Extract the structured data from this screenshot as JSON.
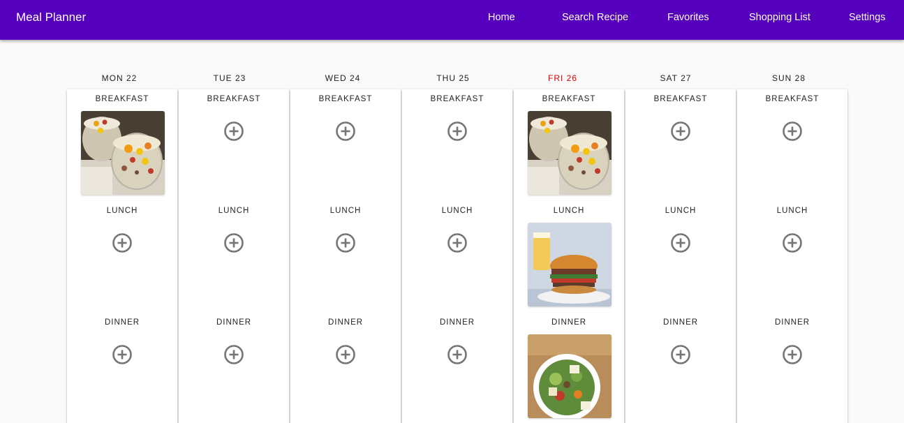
{
  "app": {
    "title": "Meal Planner"
  },
  "nav": {
    "home": "Home",
    "search": "Search Recipe",
    "favorites": "Favorites",
    "shopping": "Shopping List",
    "settings": "Settings"
  },
  "days": [
    {
      "label": "MON 22",
      "breakfast": "BREAKFAST",
      "lunch": "LUNCH",
      "dinner": "DINNER"
    },
    {
      "label": "TUE 23",
      "breakfast": "BREAKFAST",
      "lunch": "LUNCH",
      "dinner": "DINNER"
    },
    {
      "label": "WED 24",
      "breakfast": "BREAKFAST",
      "lunch": "LUNCH",
      "dinner": "DINNER"
    },
    {
      "label": "THU 25",
      "breakfast": "BREAKFAST",
      "lunch": "LUNCH",
      "dinner": "DINNER"
    },
    {
      "label": "FRI 26",
      "breakfast": "BREAKFAST",
      "lunch": "LUNCH",
      "dinner": "DINNER"
    },
    {
      "label": "SAT 27",
      "breakfast": "BREAKFAST",
      "lunch": "LUNCH",
      "dinner": "DINNER"
    },
    {
      "label": "SUN 28",
      "breakfast": "BREAKFAST",
      "lunch": "LUNCH",
      "dinner": "DINNER"
    }
  ],
  "colors": {
    "appbar": "#5500bd",
    "today": "#d50000",
    "add_icon": "#757575"
  },
  "icons": {
    "add": "add-circle-outline-icon"
  }
}
